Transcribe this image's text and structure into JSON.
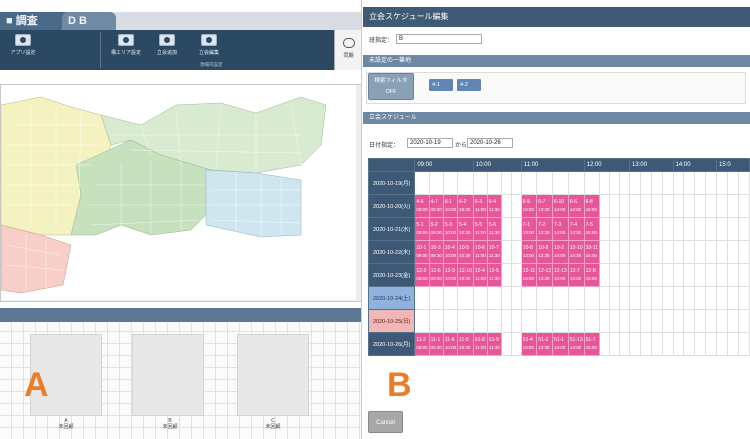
{
  "panelA": {
    "tab_active": "■ 調査",
    "tab_second": "D B",
    "toolbar": {
      "app_settings": "アプリ設定",
      "area_settings": "構エリア設定",
      "add_meeting": "立会追加",
      "edit_meeting": "立会編集",
      "group_label": "現場内設定",
      "side_btn": "同期"
    },
    "slots": [
      {
        "name": "A",
        "status": "未回顧"
      },
      {
        "name": "B",
        "status": "未回顧"
      },
      {
        "name": "C",
        "status": "未回顧"
      }
    ]
  },
  "panelB": {
    "title": "立会スケジュール編集",
    "name_label": "班指定：",
    "name_value": "B",
    "section_unset": "未設定の一筆地",
    "filter_btn_line1": "検索フィルタ",
    "filter_btn_line2": "OFF",
    "chips": [
      "4-1",
      "4-2"
    ],
    "section_schedule": "立会スケジュール",
    "date_label": "日付指定：",
    "date_from": "2020-10-19",
    "date_sep": "から",
    "date_to": "2020-10-26",
    "cancel": "Cancel"
  },
  "schedule": {
    "hours": [
      "09:00",
      "10:00",
      "11:00",
      "12:00",
      "13:00",
      "14:00",
      "15:0"
    ],
    "rows": [
      {
        "date": "2020-10-19(月)",
        "kind": "weekday",
        "busy": []
      },
      {
        "date": "2020-10-20(火)",
        "kind": "weekday",
        "busy": [
          {
            "col": 0,
            "id": "4-6",
            "t": "09:00"
          },
          {
            "col": 1,
            "id": "4-7",
            "t": "09:30"
          },
          {
            "col": 2,
            "id": "6-1",
            "t": "10:00"
          },
          {
            "col": 3,
            "id": "6-2",
            "t": "10:30"
          },
          {
            "col": 4,
            "id": "6-3",
            "t": "11:00"
          },
          {
            "col": 5,
            "id": "6-4",
            "t": "11:30"
          },
          {
            "col": 8,
            "id": "6-5",
            "t": "13:00"
          },
          {
            "col": 9,
            "id": "6-7",
            "t": "13:30"
          },
          {
            "col": 10,
            "id": "6-10",
            "t": "14:00"
          },
          {
            "col": 11,
            "id": "6-6",
            "t": "14:30"
          },
          {
            "col": 12,
            "id": "6-8",
            "t": "15:00"
          }
        ]
      },
      {
        "date": "2020-10-21(水)",
        "kind": "weekday",
        "busy": [
          {
            "col": 0,
            "id": "5-1",
            "t": "09:00"
          },
          {
            "col": 1,
            "id": "5-2",
            "t": "09:30"
          },
          {
            "col": 2,
            "id": "5-3",
            "t": "10:00"
          },
          {
            "col": 3,
            "id": "5-4",
            "t": "10:30"
          },
          {
            "col": 4,
            "id": "5-5",
            "t": "11:00"
          },
          {
            "col": 5,
            "id": "5-6",
            "t": "11:30"
          },
          {
            "col": 8,
            "id": "7-1",
            "t": "13:00"
          },
          {
            "col": 9,
            "id": "7-2",
            "t": "13:30"
          },
          {
            "col": 10,
            "id": "7-3",
            "t": "14:00"
          },
          {
            "col": 11,
            "id": "7-4",
            "t": "14:30"
          },
          {
            "col": 12,
            "id": "7-5",
            "t": "15:00"
          }
        ]
      },
      {
        "date": "2020-10-22(木)",
        "kind": "weekday",
        "busy": [
          {
            "col": 0,
            "id": "10-1",
            "t": "09:00"
          },
          {
            "col": 1,
            "id": "10-3",
            "t": "09:30"
          },
          {
            "col": 2,
            "id": "10-4",
            "t": "10:00"
          },
          {
            "col": 3,
            "id": "10-5",
            "t": "10:30"
          },
          {
            "col": 4,
            "id": "10-6",
            "t": "11:00"
          },
          {
            "col": 5,
            "id": "10-7",
            "t": "11:30"
          },
          {
            "col": 8,
            "id": "10-8",
            "t": "13:00"
          },
          {
            "col": 9,
            "id": "10-9",
            "t": "13:30"
          },
          {
            "col": 10,
            "id": "10-2",
            "t": "14:00"
          },
          {
            "col": 11,
            "id": "10-10",
            "t": "14:30"
          },
          {
            "col": 12,
            "id": "10-11",
            "t": "15:00"
          }
        ]
      },
      {
        "date": "2020-10-23(金)",
        "kind": "weekday",
        "busy": [
          {
            "col": 0,
            "id": "12-2",
            "t": "09:00"
          },
          {
            "col": 1,
            "id": "12-6",
            "t": "09:30"
          },
          {
            "col": 2,
            "id": "12-9",
            "t": "10:00"
          },
          {
            "col": 3,
            "id": "12-10",
            "t": "10:30"
          },
          {
            "col": 4,
            "id": "12-4",
            "t": "11:00"
          },
          {
            "col": 5,
            "id": "12-5",
            "t": "11:30"
          },
          {
            "col": 8,
            "id": "12-11",
            "t": "13:00"
          },
          {
            "col": 9,
            "id": "12-12",
            "t": "13:30"
          },
          {
            "col": 10,
            "id": "12-13",
            "t": "14:00"
          },
          {
            "col": 11,
            "id": "12-7",
            "t": "14:30"
          },
          {
            "col": 12,
            "id": "12-8",
            "t": "15:00"
          }
        ]
      },
      {
        "date": "2020-10-24(土)",
        "kind": "sat",
        "busy": []
      },
      {
        "date": "2020-10-25(日)",
        "kind": "sun",
        "busy": []
      },
      {
        "date": "2020-10-26(月)",
        "kind": "weekday",
        "busy": [
          {
            "col": 0,
            "id": "11-2",
            "t": "09:00"
          },
          {
            "col": 1,
            "id": "11-1",
            "t": "09:30"
          },
          {
            "col": 2,
            "id": "11-6",
            "t": "10:00"
          },
          {
            "col": 3,
            "id": "11-5",
            "t": "10:30"
          },
          {
            "col": 4,
            "id": "51-8",
            "t": "11:00"
          },
          {
            "col": 5,
            "id": "51-9",
            "t": "11:30"
          },
          {
            "col": 8,
            "id": "51-4",
            "t": "13:00"
          },
          {
            "col": 9,
            "id": "51-2",
            "t": "13:30"
          },
          {
            "col": 10,
            "id": "51-1",
            "t": "14:00"
          },
          {
            "col": 11,
            "id": "51-13",
            "t": "14:30"
          },
          {
            "col": 12,
            "id": "51-7",
            "t": "15:00"
          }
        ]
      }
    ]
  },
  "labels": {
    "a": "A",
    "b": "B"
  },
  "colors": {
    "header": "#3e5975",
    "busy": "#e8569a",
    "saturday": "#8fb3dc",
    "sunday": "#f1b7b4",
    "annotation": "#e97d2a"
  }
}
